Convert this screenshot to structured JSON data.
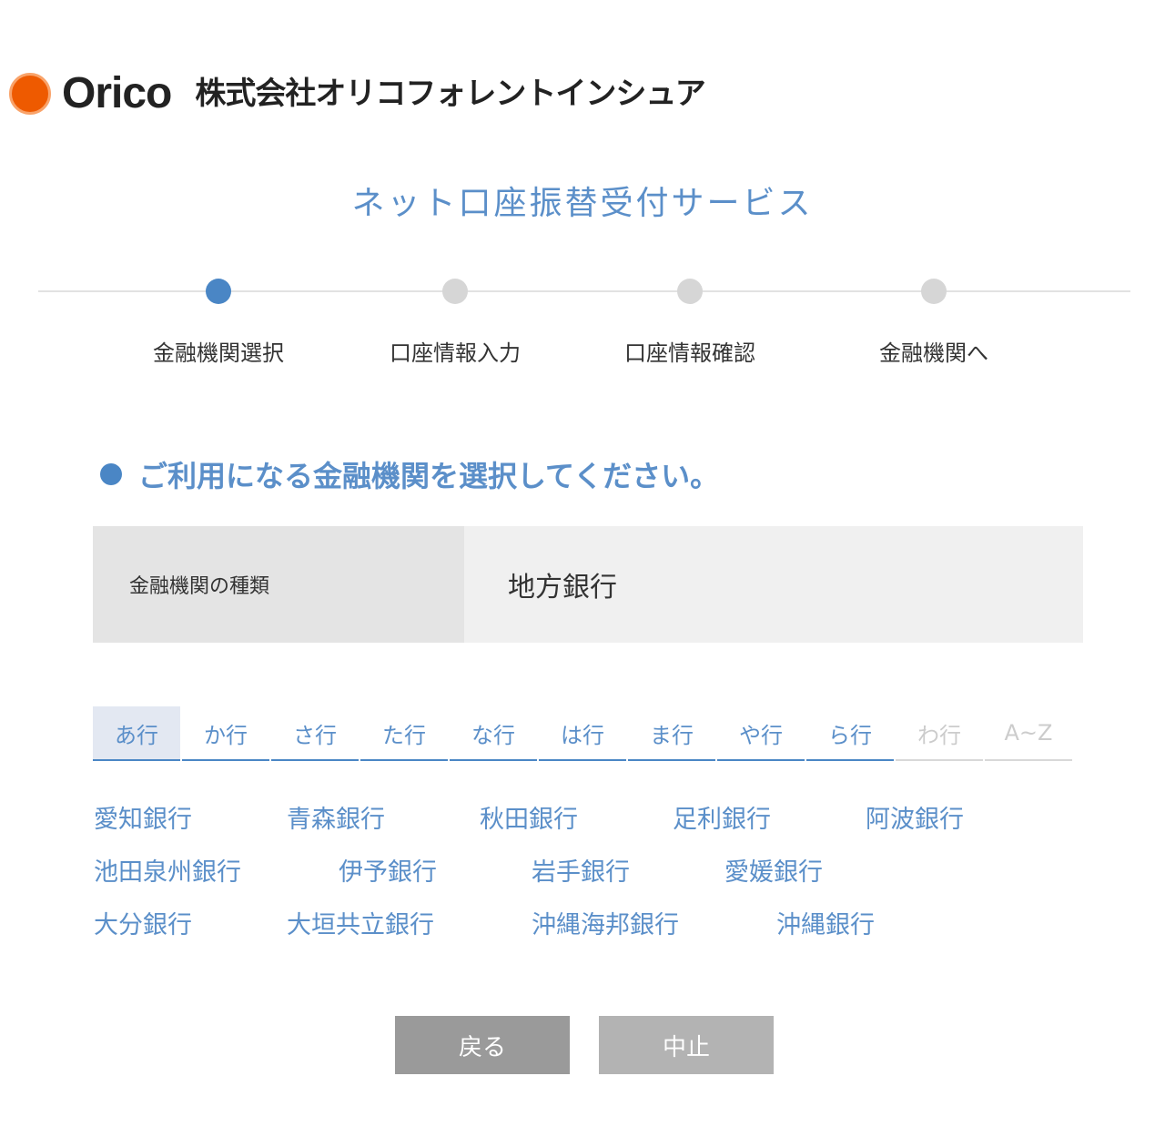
{
  "header": {
    "logo_word": "Orico",
    "company_name": "株式会社オリコフォレントインシュア"
  },
  "service_title": "ネット口座振替受付サービス",
  "steps": [
    {
      "label": "金融機関選択",
      "active": true
    },
    {
      "label": "口座情報入力",
      "active": false
    },
    {
      "label": "口座情報確認",
      "active": false
    },
    {
      "label": "金融機関へ",
      "active": false
    }
  ],
  "instruction": "ご利用になる金融機関を選択してください。",
  "institution_type": {
    "label": "金融機関の種類",
    "value": "地方銀行"
  },
  "tabs": [
    {
      "label": "あ行",
      "state": "active"
    },
    {
      "label": "か行",
      "state": "normal"
    },
    {
      "label": "さ行",
      "state": "normal"
    },
    {
      "label": "た行",
      "state": "normal"
    },
    {
      "label": "な行",
      "state": "normal"
    },
    {
      "label": "は行",
      "state": "normal"
    },
    {
      "label": "ま行",
      "state": "normal"
    },
    {
      "label": "や行",
      "state": "normal"
    },
    {
      "label": "ら行",
      "state": "normal"
    },
    {
      "label": "わ行",
      "state": "disabled"
    },
    {
      "label": "A~Z",
      "state": "disabled"
    }
  ],
  "banks": [
    "愛知銀行",
    "青森銀行",
    "秋田銀行",
    "足利銀行",
    "阿波銀行",
    "池田泉州銀行",
    "伊予銀行",
    "岩手銀行",
    "愛媛銀行",
    "大分銀行",
    "大垣共立銀行",
    "沖縄海邦銀行",
    "沖縄銀行"
  ],
  "buttons": {
    "back": "戻る",
    "cancel": "中止"
  },
  "colors": {
    "accent": "#5b8fc9",
    "step_active": "#4a86c5",
    "brand_orange": "#ee5a00"
  }
}
